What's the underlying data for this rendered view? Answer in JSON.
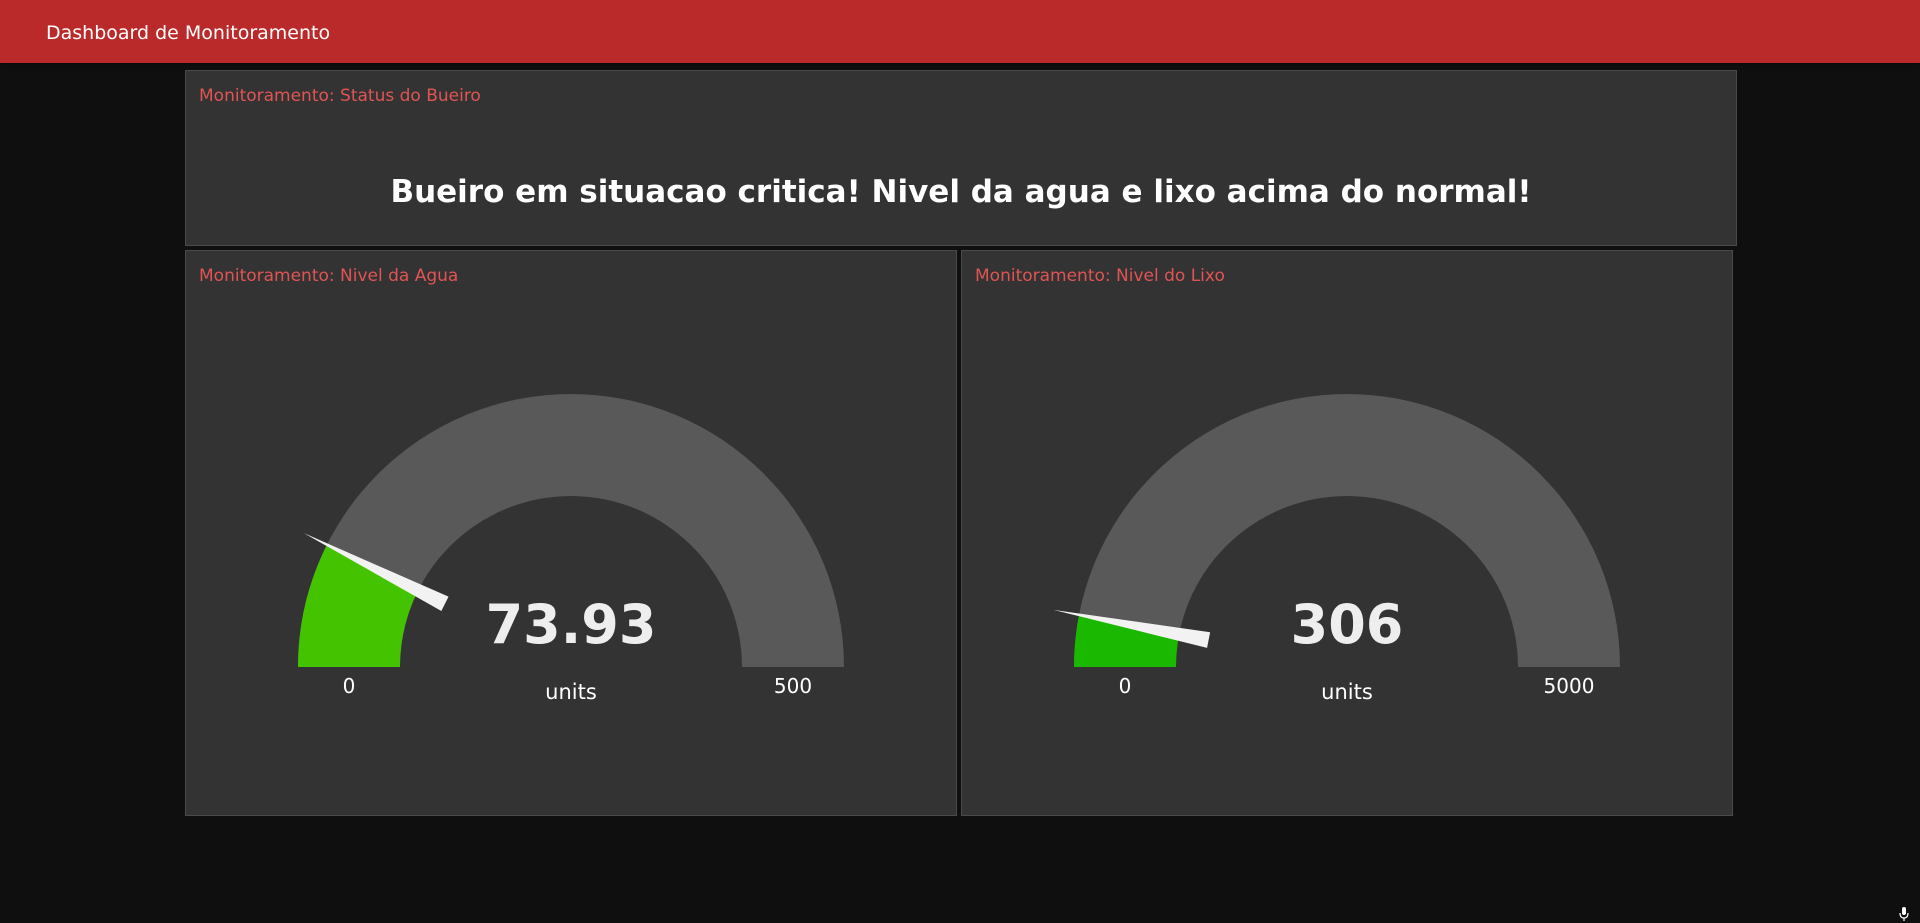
{
  "header": {
    "title": "Dashboard de Monitoramento"
  },
  "status_card": {
    "title": "Monitoramento: Status do Bueiro",
    "message": "Bueiro em situacao critica! Nivel da agua e lixo acima do normal!"
  },
  "gauges": [
    {
      "title": "Monitoramento: Nivel da Agua",
      "value": 73.93,
      "value_label": "73.93",
      "units": "units",
      "min": 0,
      "max": 500,
      "min_label": "0",
      "max_label": "500",
      "fill_color": "#44c400"
    },
    {
      "title": "Monitoramento: Nivel do Lixo",
      "value": 306,
      "value_label": "306",
      "units": "units",
      "min": 0,
      "max": 5000,
      "min_label": "0",
      "max_label": "5000",
      "fill_color": "#1ab900"
    }
  ],
  "colors": {
    "header_bg": "#bb2a2a",
    "page_bg": "#0f0f0f",
    "card_bg": "#333333",
    "card_title": "#e05454",
    "gauge_track": "#595959",
    "needle": "#f2f2f2"
  }
}
